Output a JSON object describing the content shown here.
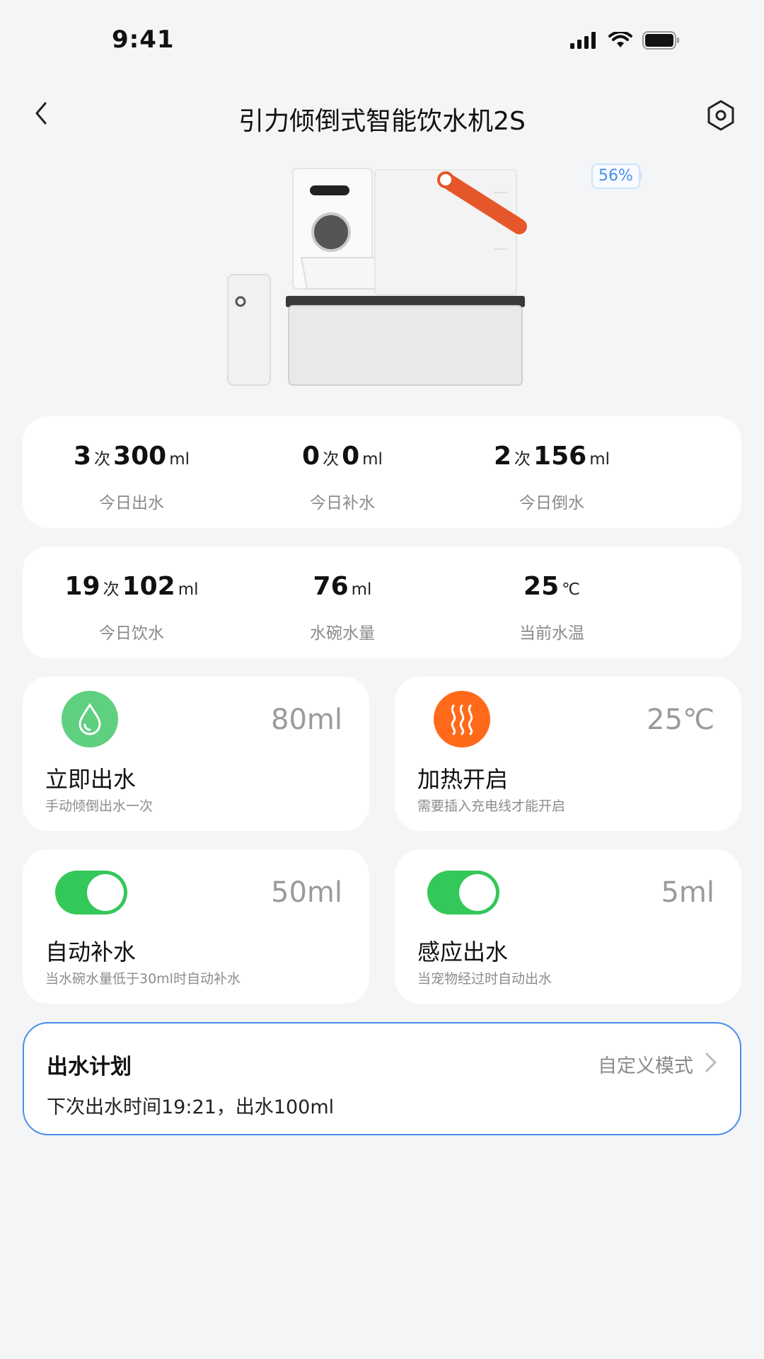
{
  "status_bar": {
    "time": "9:41"
  },
  "header": {
    "title": "引力倾倒式智能饮水机2S"
  },
  "device": {
    "battery": "56%"
  },
  "stats_row1": [
    {
      "count": "3",
      "count_unit": "次",
      "volume": "300",
      "volume_unit": "ml",
      "label": "今日出水"
    },
    {
      "count": "0",
      "count_unit": "次",
      "volume": "0",
      "volume_unit": "ml",
      "label": "今日补水"
    },
    {
      "count": "2",
      "count_unit": "次",
      "volume": "156",
      "volume_unit": "ml",
      "label": "今日倒水"
    }
  ],
  "stats_row2": [
    {
      "count": "19",
      "count_unit": "次",
      "volume": "102",
      "volume_unit": "ml",
      "label": "今日饮水"
    },
    {
      "volume": "76",
      "volume_unit": "ml",
      "label": "水碗水量"
    },
    {
      "volume": "25",
      "volume_unit": "℃",
      "label": "当前水温"
    }
  ],
  "tiles": {
    "dispense": {
      "title": "立即出水",
      "subtitle": "手动倾倒出水一次",
      "amount": "80ml",
      "icon": "water-drop-icon",
      "color": "#5fcf80"
    },
    "heating": {
      "title": "加热开启",
      "subtitle": "需要插入充电线才能开启",
      "amount": "25℃",
      "icon": "heat-icon",
      "color": "#ff6a1a"
    },
    "auto_refill": {
      "title": "自动补水",
      "subtitle": "当水碗水量低于30ml时自动补水",
      "amount": "50ml",
      "enabled": true
    },
    "sensor": {
      "title": "感应出水",
      "subtitle": "当宠物经过时自动出水",
      "amount": "5ml",
      "enabled": true
    }
  },
  "plan": {
    "title": "出水计划",
    "mode": "自定义模式",
    "description": "下次出水时间19:21，出水100ml"
  },
  "colors": {
    "accent": "#4a8ee8",
    "toggle_on": "#34c759",
    "background": "#f4f5f7"
  }
}
